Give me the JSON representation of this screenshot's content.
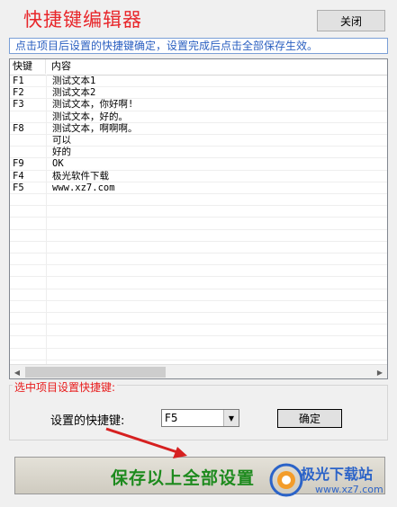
{
  "window": {
    "title": "快捷键编辑器",
    "close_label": "关闭"
  },
  "hint": "点击项目后设置的快捷键确定，设置完成后点击全部保存生效。",
  "list": {
    "headers": {
      "key": "快键",
      "content": "内容"
    },
    "rows": [
      {
        "key": "F1",
        "content": "测试文本1"
      },
      {
        "key": "F2",
        "content": "测试文本2"
      },
      {
        "key": "F3",
        "content": "测试文本，你好啊!"
      },
      {
        "key": "",
        "content": "测试文本，好的。"
      },
      {
        "key": "F8",
        "content": "测试文本，啊啊啊。"
      },
      {
        "key": "",
        "content": "可以"
      },
      {
        "key": "",
        "content": "好的"
      },
      {
        "key": "F9",
        "content": "OK"
      },
      {
        "key": "F4",
        "content": "极光软件下载"
      },
      {
        "key": "F5",
        "content": "www.xz7.com"
      }
    ]
  },
  "hotkey_group": {
    "legend": "选中项目设置快捷键:",
    "label": "设置的快捷键:",
    "selected": "F5",
    "confirm_label": "确定"
  },
  "save_label": "保存以上全部设置",
  "watermark": {
    "name": "极光下载站",
    "url": "www.xz7.com"
  },
  "colors": {
    "title": "#e8262a",
    "hint_text": "#2a5fc0",
    "legend": "#e81b1b",
    "save_text": "#1d8a1d",
    "arrow": "#d62020"
  }
}
